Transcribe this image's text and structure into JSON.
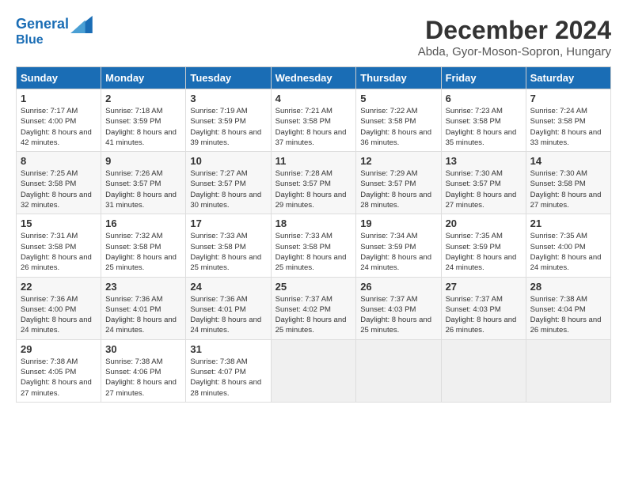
{
  "header": {
    "logo_line1": "General",
    "logo_line2": "Blue",
    "month": "December 2024",
    "location": "Abda, Gyor-Moson-Sopron, Hungary"
  },
  "days_of_week": [
    "Sunday",
    "Monday",
    "Tuesday",
    "Wednesday",
    "Thursday",
    "Friday",
    "Saturday"
  ],
  "weeks": [
    [
      {
        "day": "1",
        "sunrise": "7:17 AM",
        "sunset": "4:00 PM",
        "daylight": "8 hours and 42 minutes."
      },
      {
        "day": "2",
        "sunrise": "7:18 AM",
        "sunset": "3:59 PM",
        "daylight": "8 hours and 41 minutes."
      },
      {
        "day": "3",
        "sunrise": "7:19 AM",
        "sunset": "3:59 PM",
        "daylight": "8 hours and 39 minutes."
      },
      {
        "day": "4",
        "sunrise": "7:21 AM",
        "sunset": "3:58 PM",
        "daylight": "8 hours and 37 minutes."
      },
      {
        "day": "5",
        "sunrise": "7:22 AM",
        "sunset": "3:58 PM",
        "daylight": "8 hours and 36 minutes."
      },
      {
        "day": "6",
        "sunrise": "7:23 AM",
        "sunset": "3:58 PM",
        "daylight": "8 hours and 35 minutes."
      },
      {
        "day": "7",
        "sunrise": "7:24 AM",
        "sunset": "3:58 PM",
        "daylight": "8 hours and 33 minutes."
      }
    ],
    [
      {
        "day": "8",
        "sunrise": "7:25 AM",
        "sunset": "3:58 PM",
        "daylight": "8 hours and 32 minutes."
      },
      {
        "day": "9",
        "sunrise": "7:26 AM",
        "sunset": "3:57 PM",
        "daylight": "8 hours and 31 minutes."
      },
      {
        "day": "10",
        "sunrise": "7:27 AM",
        "sunset": "3:57 PM",
        "daylight": "8 hours and 30 minutes."
      },
      {
        "day": "11",
        "sunrise": "7:28 AM",
        "sunset": "3:57 PM",
        "daylight": "8 hours and 29 minutes."
      },
      {
        "day": "12",
        "sunrise": "7:29 AM",
        "sunset": "3:57 PM",
        "daylight": "8 hours and 28 minutes."
      },
      {
        "day": "13",
        "sunrise": "7:30 AM",
        "sunset": "3:57 PM",
        "daylight": "8 hours and 27 minutes."
      },
      {
        "day": "14",
        "sunrise": "7:30 AM",
        "sunset": "3:58 PM",
        "daylight": "8 hours and 27 minutes."
      }
    ],
    [
      {
        "day": "15",
        "sunrise": "7:31 AM",
        "sunset": "3:58 PM",
        "daylight": "8 hours and 26 minutes."
      },
      {
        "day": "16",
        "sunrise": "7:32 AM",
        "sunset": "3:58 PM",
        "daylight": "8 hours and 25 minutes."
      },
      {
        "day": "17",
        "sunrise": "7:33 AM",
        "sunset": "3:58 PM",
        "daylight": "8 hours and 25 minutes."
      },
      {
        "day": "18",
        "sunrise": "7:33 AM",
        "sunset": "3:58 PM",
        "daylight": "8 hours and 25 minutes."
      },
      {
        "day": "19",
        "sunrise": "7:34 AM",
        "sunset": "3:59 PM",
        "daylight": "8 hours and 24 minutes."
      },
      {
        "day": "20",
        "sunrise": "7:35 AM",
        "sunset": "3:59 PM",
        "daylight": "8 hours and 24 minutes."
      },
      {
        "day": "21",
        "sunrise": "7:35 AM",
        "sunset": "4:00 PM",
        "daylight": "8 hours and 24 minutes."
      }
    ],
    [
      {
        "day": "22",
        "sunrise": "7:36 AM",
        "sunset": "4:00 PM",
        "daylight": "8 hours and 24 minutes."
      },
      {
        "day": "23",
        "sunrise": "7:36 AM",
        "sunset": "4:01 PM",
        "daylight": "8 hours and 24 minutes."
      },
      {
        "day": "24",
        "sunrise": "7:36 AM",
        "sunset": "4:01 PM",
        "daylight": "8 hours and 24 minutes."
      },
      {
        "day": "25",
        "sunrise": "7:37 AM",
        "sunset": "4:02 PM",
        "daylight": "8 hours and 25 minutes."
      },
      {
        "day": "26",
        "sunrise": "7:37 AM",
        "sunset": "4:03 PM",
        "daylight": "8 hours and 25 minutes."
      },
      {
        "day": "27",
        "sunrise": "7:37 AM",
        "sunset": "4:03 PM",
        "daylight": "8 hours and 26 minutes."
      },
      {
        "day": "28",
        "sunrise": "7:38 AM",
        "sunset": "4:04 PM",
        "daylight": "8 hours and 26 minutes."
      }
    ],
    [
      {
        "day": "29",
        "sunrise": "7:38 AM",
        "sunset": "4:05 PM",
        "daylight": "8 hours and 27 minutes."
      },
      {
        "day": "30",
        "sunrise": "7:38 AM",
        "sunset": "4:06 PM",
        "daylight": "8 hours and 27 minutes."
      },
      {
        "day": "31",
        "sunrise": "7:38 AM",
        "sunset": "4:07 PM",
        "daylight": "8 hours and 28 minutes."
      },
      null,
      null,
      null,
      null
    ]
  ]
}
